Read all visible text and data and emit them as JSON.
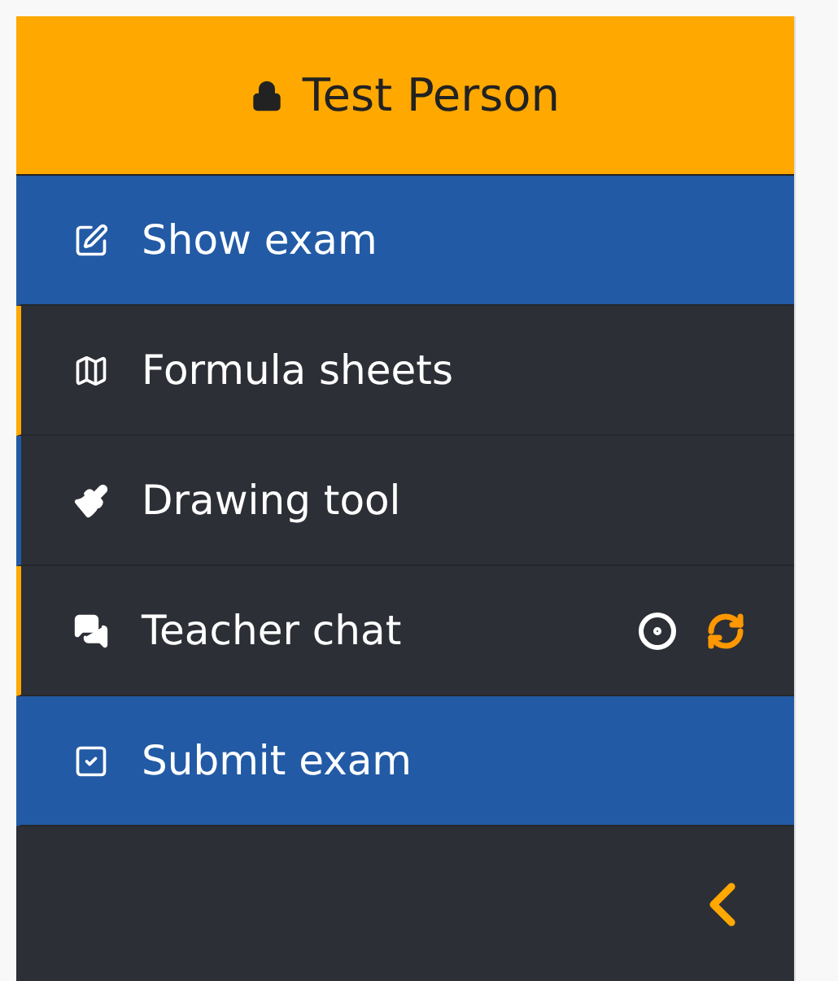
{
  "user": {
    "name": "Test Person"
  },
  "menu": [
    {
      "label": "Show exam",
      "kind": "action"
    },
    {
      "label": "Formula sheets",
      "kind": "panel",
      "color": "#ffa800"
    },
    {
      "label": "Drawing tool",
      "kind": "panel",
      "color": "#225aa5"
    },
    {
      "label": "Teacher chat",
      "kind": "panel",
      "color": "#ffa800",
      "indicators": [
        {
          "kind": "status"
        },
        {
          "kind": "sync"
        }
      ]
    },
    {
      "label": "Submit exam",
      "kind": "action"
    }
  ]
}
